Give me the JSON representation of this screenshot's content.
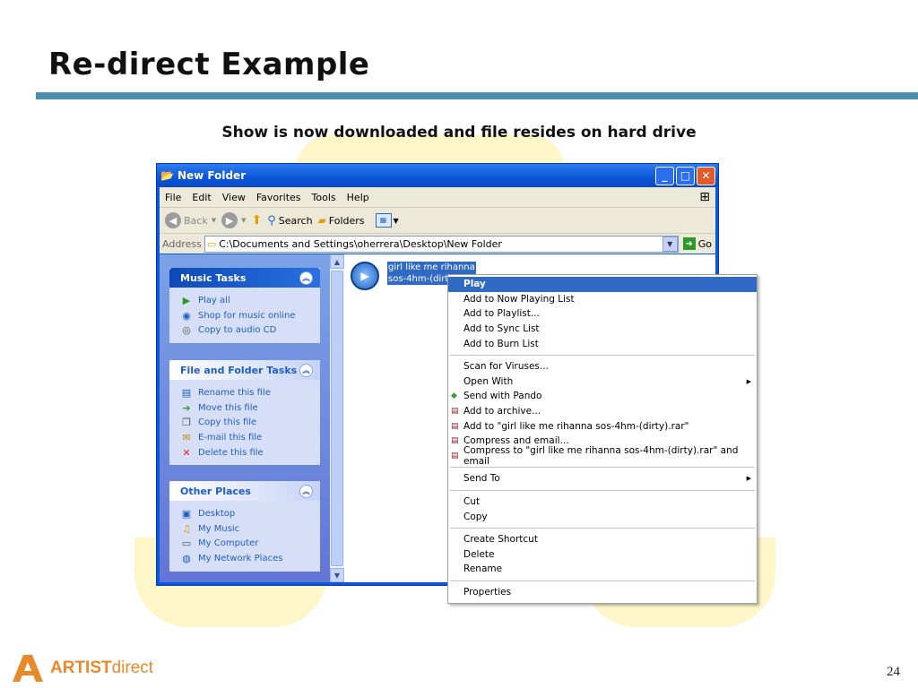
{
  "slide": {
    "title": "Re-direct Example",
    "subtitle": "Show is now downloaded and file resides on hard drive",
    "page_number": "24",
    "logo": {
      "bold": "ARTIST",
      "light": "direct"
    }
  },
  "window": {
    "title": "New Folder",
    "menu": [
      "File",
      "Edit",
      "View",
      "Favorites",
      "Tools",
      "Help"
    ],
    "toolbar": {
      "back": "Back",
      "search": "Search",
      "folders": "Folders"
    },
    "address": {
      "label": "Address",
      "value": "C:\\Documents and Settings\\oherrera\\Desktop\\New Folder",
      "go": "Go"
    }
  },
  "taskpane": {
    "music_tasks": {
      "title": "Music Tasks",
      "items": [
        "Play all",
        "Shop for music online",
        "Copy to audio CD"
      ]
    },
    "file_tasks": {
      "title": "File and Folder Tasks",
      "items": [
        "Rename this file",
        "Move this file",
        "Copy this file",
        "E-mail this file",
        "Delete this file"
      ]
    },
    "other_places": {
      "title": "Other Places",
      "items": [
        "Desktop",
        "My Music",
        "My Computer",
        "My Network Places"
      ]
    }
  },
  "file": {
    "line1": "girl like me rihanna",
    "line2": "sos-4hm-(dirty"
  },
  "context_menu": {
    "group1": [
      "Play",
      "Add to Now Playing List",
      "Add to Playlist...",
      "Add to Sync List",
      "Add to Burn List"
    ],
    "group2": [
      "Scan for Viruses...",
      "Open With",
      "Send with Pando",
      "Add to archive...",
      "Add to \"girl like me rihanna sos-4hm-(dirty).rar\"",
      "Compress and email...",
      "Compress to \"girl like me rihanna sos-4hm-(dirty).rar\" and email"
    ],
    "group3": [
      "Send To"
    ],
    "group4": [
      "Cut",
      "Copy"
    ],
    "group5": [
      "Create Shortcut",
      "Delete",
      "Rename"
    ],
    "group6": [
      "Properties"
    ]
  },
  "colors": {
    "title_rule": "#4a8fb0",
    "xp_blue": "#0a58d8",
    "selection": "#316ac5",
    "logo_orange": "#e8892a",
    "bg_blob": "#fdf6c8"
  }
}
